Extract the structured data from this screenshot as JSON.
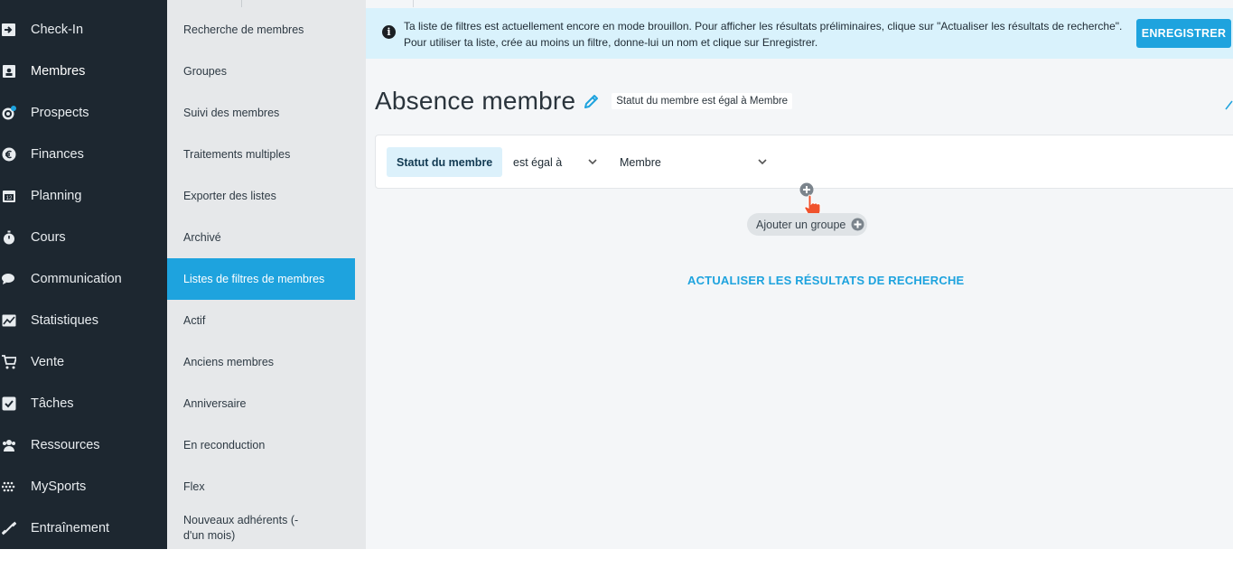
{
  "nav": {
    "items": [
      {
        "label": "Check-In",
        "icon": "sign-in-icon"
      },
      {
        "label": "Membres",
        "icon": "id-card-icon"
      },
      {
        "label": "Prospects",
        "icon": "target-icon"
      },
      {
        "label": "Finances",
        "icon": "euro-icon"
      },
      {
        "label": "Planning",
        "icon": "calendar-icon"
      },
      {
        "label": "Cours",
        "icon": "stopwatch-icon"
      },
      {
        "label": "Communication",
        "icon": "chat-icon"
      },
      {
        "label": "Statistiques",
        "icon": "chart-icon"
      },
      {
        "label": "Vente",
        "icon": "cart-icon"
      },
      {
        "label": "Tâches",
        "icon": "checkbox-icon"
      },
      {
        "label": "Ressources",
        "icon": "users-icon"
      },
      {
        "label": "MySports",
        "icon": "dots-icon"
      },
      {
        "label": "Entraînement",
        "icon": "dumbbell-icon"
      }
    ],
    "active_index": 1
  },
  "submenu": {
    "items": [
      "Recherche de membres",
      "Groupes",
      "Suivi des membres",
      "Traitements multiples",
      "Exporter des listes",
      "Archivé",
      "Listes de filtres de membres",
      "Actif",
      "Anciens membres",
      "Anniversaire",
      "En reconduction",
      "Flex",
      "Nouveaux adhérents (- d'un mois)"
    ],
    "active_index": 6
  },
  "banner": {
    "line1": "Ta liste de filtres est actuellement encore en mode brouillon. Pour afficher les résultats préliminaires, clique sur \"Actualiser les résultats de recherche\".",
    "line2": "Pour utiliser ta liste, crée au moins un filtre, donne-lui un nom et clique sur Enregistrer.",
    "save_label": "ENREGISTRER"
  },
  "page": {
    "title": "Absence membre",
    "tag": "Statut du membre est égal à Membre"
  },
  "filter": {
    "field": "Statut du membre",
    "operator": "est égal à",
    "value": "Membre"
  },
  "actions": {
    "add_group": "Ajouter un groupe",
    "refresh": "ACTUALISER LES RÉSULTATS DE RECHERCHE"
  },
  "colors": {
    "accent": "#1ea3de",
    "nav_bg": "#1d2730",
    "banner_bg": "#d9f2fc",
    "cursor_hand": "#f0522d"
  }
}
